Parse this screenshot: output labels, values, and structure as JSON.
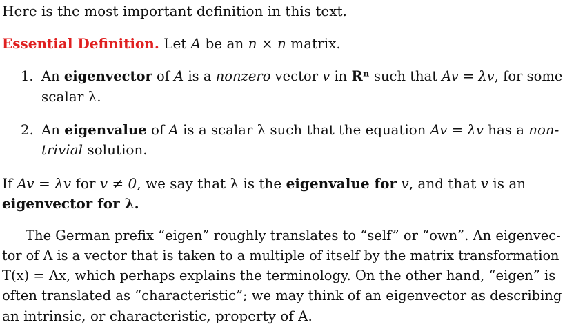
{
  "intro": "Here is the most important definition in this text.",
  "definition": {
    "heading": "Essential Definition.",
    "intro_a": "Let ",
    "A": "A",
    "intro_b": " be an ",
    "nxn": "n × n",
    "intro_c": " matrix."
  },
  "items": [
    {
      "number": "1.",
      "line1": {
        "t1": "An ",
        "term": "eigenvector",
        "t2": " of ",
        "A": "A",
        "t3": " is a ",
        "nonzero": "nonzero",
        "t4": " vector ",
        "v": "v",
        "t5": " in ",
        "Rn": "Rⁿ",
        "t6": " such that ",
        "eq": "Av = λv",
        "t7": ", for some"
      },
      "line2": "scalar λ."
    },
    {
      "number": "2.",
      "line1": {
        "t1": "An ",
        "term": "eigenvalue",
        "t2": " of ",
        "A": "A",
        "t3": " is a scalar λ such that the equation ",
        "eq": "Av = λv",
        "t4": " has a ",
        "non": "non-"
      },
      "line2": {
        "trivial": "trivial",
        "rest": " solution."
      }
    }
  ],
  "remark": {
    "line1": {
      "t1": "If ",
      "eq": "Av = λv",
      "t2": " for ",
      "cond": "v ≠ 0",
      "t3": ", we say that λ is the ",
      "term1": "eigenvalue for",
      "t4": " ",
      "v1": "v",
      "t5": ", and that ",
      "v2": "v",
      "t6": " is an"
    },
    "line2": "eigenvector for λ."
  },
  "paragraph": {
    "lines": [
      "The German prefix “eigen” roughly translates to “self” or “own”. An eigenvec-",
      "tor of A is a vector that is taken to a multiple of itself by the matrix transformation",
      "T(x) = Ax, which perhaps explains the terminology. On the other hand, “eigen” is",
      "often translated as “characteristic”; we may think of an eigenvector as describing",
      "an intrinsic, or characteristic, property of A."
    ]
  }
}
